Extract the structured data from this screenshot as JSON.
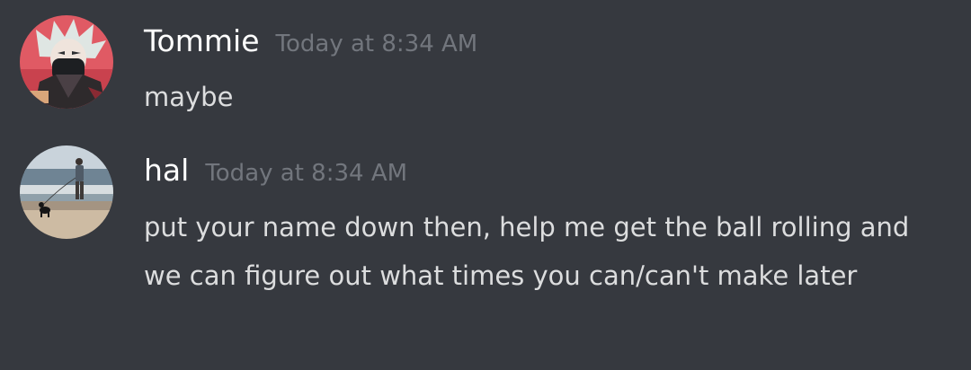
{
  "messages": [
    {
      "author": "Tommie",
      "timestamp": "Today at 8:34 AM",
      "text": "maybe",
      "avatar_icon": "anime-character-avatar"
    },
    {
      "author": "hal",
      "timestamp": "Today at 8:34 AM",
      "text": "put your name down then, help me get the ball rolling and we can figure out what times you can/can't make later",
      "avatar_icon": "beach-photo-avatar"
    }
  ],
  "colors": {
    "background": "#36393f",
    "username": "#ffffff",
    "timestamp": "#72767d",
    "message_text": "#dcddde"
  }
}
